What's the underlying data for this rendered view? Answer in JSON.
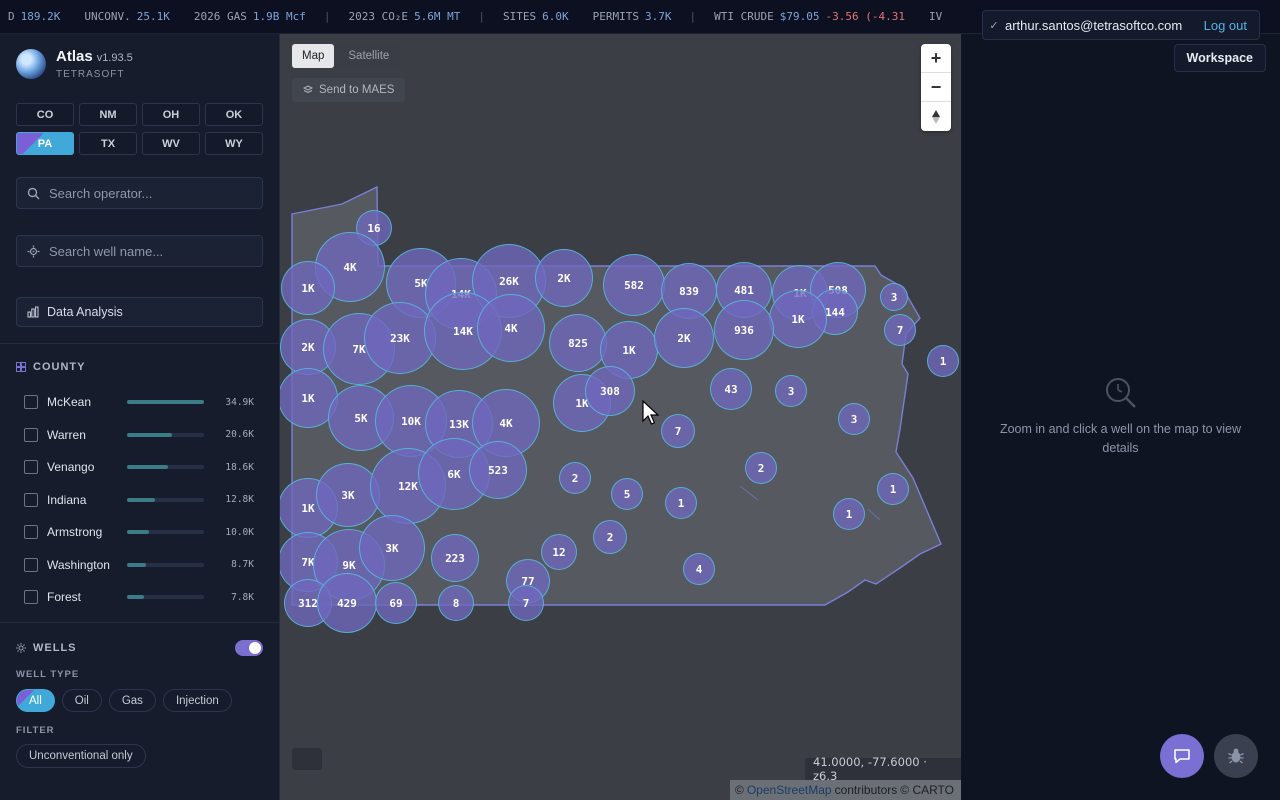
{
  "ticker": [
    {
      "label": "D",
      "value": "189.2K"
    },
    {
      "label": "UNCONV.",
      "value": "25.1K"
    },
    {
      "label": "2026 GAS",
      "value": "1.9B Mcf"
    },
    {
      "label": "2023 CO₂E",
      "value": "5.6M MT"
    },
    {
      "label": "SITES",
      "value": "6.0K"
    },
    {
      "label": "PERMITS",
      "value": "3.7K"
    },
    {
      "label": "WTI CRUDE",
      "value": "$79.05",
      "change": "-3.56 (-4.31"
    },
    {
      "label": "IV",
      "value": ""
    }
  ],
  "user": {
    "email": "arthur.santos@tetrasoftco.com",
    "logout": "Log out"
  },
  "brand": {
    "name": "Atlas",
    "version": "v1.93.5",
    "org": "TETRASOFT"
  },
  "states": [
    {
      "code": "CO",
      "active": false
    },
    {
      "code": "NM",
      "active": false
    },
    {
      "code": "OH",
      "active": false
    },
    {
      "code": "OK",
      "active": false
    },
    {
      "code": "PA",
      "active": true
    },
    {
      "code": "TX",
      "active": false
    },
    {
      "code": "WV",
      "active": false
    },
    {
      "code": "WY",
      "active": false
    }
  ],
  "search_operator": {
    "placeholder": "Search operator..."
  },
  "search_well": {
    "placeholder": "Search well name..."
  },
  "data_analysis": {
    "label": "Data Analysis"
  },
  "county": {
    "heading": "COUNTY",
    "items": [
      {
        "name": "McKean",
        "value": "34.9K",
        "fraction": 1.0
      },
      {
        "name": "Warren",
        "value": "20.6K",
        "fraction": 0.59
      },
      {
        "name": "Venango",
        "value": "18.6K",
        "fraction": 0.53
      },
      {
        "name": "Indiana",
        "value": "12.8K",
        "fraction": 0.37
      },
      {
        "name": "Armstrong",
        "value": "10.0K",
        "fraction": 0.29
      },
      {
        "name": "Washington",
        "value": "8.7K",
        "fraction": 0.25
      },
      {
        "name": "Forest",
        "value": "7.8K",
        "fraction": 0.22
      }
    ]
  },
  "wells": {
    "heading": "WELLS",
    "enabled": true,
    "type_label": "WELL TYPE",
    "types": [
      {
        "label": "All",
        "active": true
      },
      {
        "label": "Oil",
        "active": false
      },
      {
        "label": "Gas",
        "active": false
      },
      {
        "label": "Injection",
        "active": false
      }
    ],
    "filter_label": "FILTER",
    "filter_chip": "Unconventional only"
  },
  "map": {
    "toggle": [
      {
        "label": "Map",
        "active": true
      },
      {
        "label": "Satellite",
        "active": false
      }
    ],
    "send_label": "Send to MAES",
    "zoom_in": "+",
    "zoom_out": "−",
    "coords": "41.0000, -77.6000 · z6.3",
    "attribution": {
      "copy1": "©",
      "osm": "OpenStreetMap",
      "contributors": "contributors",
      "copy2": "© CARTO"
    },
    "clusters": [
      "16",
      "4K",
      "1K",
      "5K",
      "14K",
      "26K",
      "2K",
      "582",
      "839",
      "481",
      "1K",
      "508",
      "3",
      "144",
      "1K",
      "7",
      "2K",
      "7K",
      "23K",
      "14K",
      "4K",
      "825",
      "1K",
      "2K",
      "936",
      "1",
      "1K",
      "5K",
      "10K",
      "13K",
      "4K",
      "1K",
      "308",
      "43",
      "3",
      "3",
      "7",
      "1K",
      "3K",
      "12K",
      "6K",
      "523",
      "2",
      "5",
      "1",
      "2",
      "1",
      "1",
      "7K",
      "9K",
      "3K",
      "223",
      "12",
      "2",
      "77",
      "4",
      "312",
      "429",
      "69",
      "8",
      "7"
    ]
  },
  "panel": {
    "workspace": "Workspace",
    "empty_text_1": "Zoom in and click a well on the map to view",
    "empty_text_2": "details"
  },
  "colors": {
    "accent": "#7b6fd0",
    "link": "#4fb3e6",
    "cluster_fill": "#7068be",
    "cluster_stroke": "#50c8e6"
  }
}
